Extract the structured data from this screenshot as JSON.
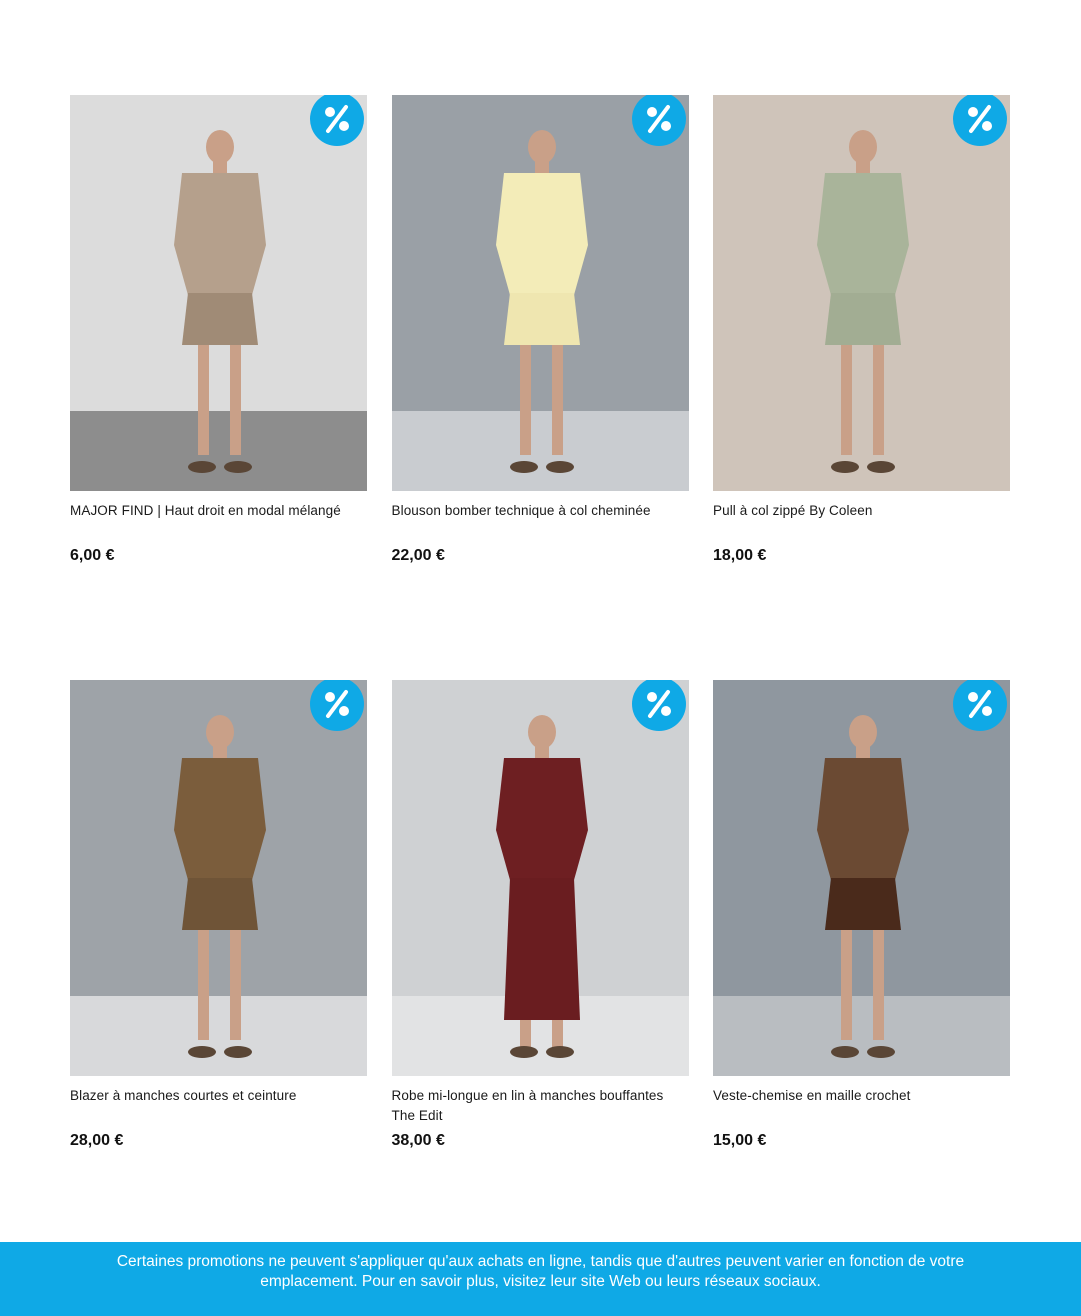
{
  "colors": {
    "accent": "#0fa9e6",
    "banner_text": "#ffffff"
  },
  "products": [
    {
      "title": "MAJOR FIND | Haut droit en modal mélangé",
      "price": "6,00 €",
      "badge_icon": "percent-icon",
      "bg": "#dcdcdc",
      "floor": "#8d8d8d",
      "outfit": "#b5a08c",
      "outfit2": "#a08b76"
    },
    {
      "title": "Blouson bomber technique à col cheminée",
      "price": "22,00 €",
      "badge_icon": "percent-icon",
      "bg": "#9aa0a6",
      "floor": "#c9ccd0",
      "outfit": "#f3ecb8",
      "outfit2": "#efe6b0"
    },
    {
      "title": "Pull à col zippé By Coleen",
      "price": "18,00 €",
      "badge_icon": "percent-icon",
      "bg": "#cfc4ba",
      "floor": "#cfc4ba",
      "outfit": "#a9b49a",
      "outfit2": "#a2ad93"
    },
    {
      "title": "Blazer à manches courtes et ceinture",
      "price": "28,00 €",
      "badge_icon": "percent-icon",
      "bg": "#9ea3a8",
      "floor": "#d8d9db",
      "outfit": "#7b5d3c",
      "outfit2": "#6f5437"
    },
    {
      "title": "Robe mi-longue en lin à manches bouffantes The Edit",
      "price": "38,00 €",
      "badge_icon": "percent-icon",
      "bg": "#cfd1d3",
      "floor": "#e2e3e4",
      "outfit": "#6e1f22",
      "outfit2": "#6a1d20"
    },
    {
      "title": "Veste-chemise en maille crochet",
      "price": "15,00 €",
      "badge_icon": "percent-icon",
      "bg": "#8f979f",
      "floor": "#b9bdc1",
      "outfit": "#6b4a33",
      "outfit2": "#4a2a1b"
    }
  ],
  "footer": {
    "text": "Certaines promotions ne peuvent s'appliquer qu'aux achats en ligne, tandis que d'autres peuvent varier en fonction de votre emplacement. Pour en savoir plus, visitez leur site Web ou leurs réseaux sociaux."
  }
}
